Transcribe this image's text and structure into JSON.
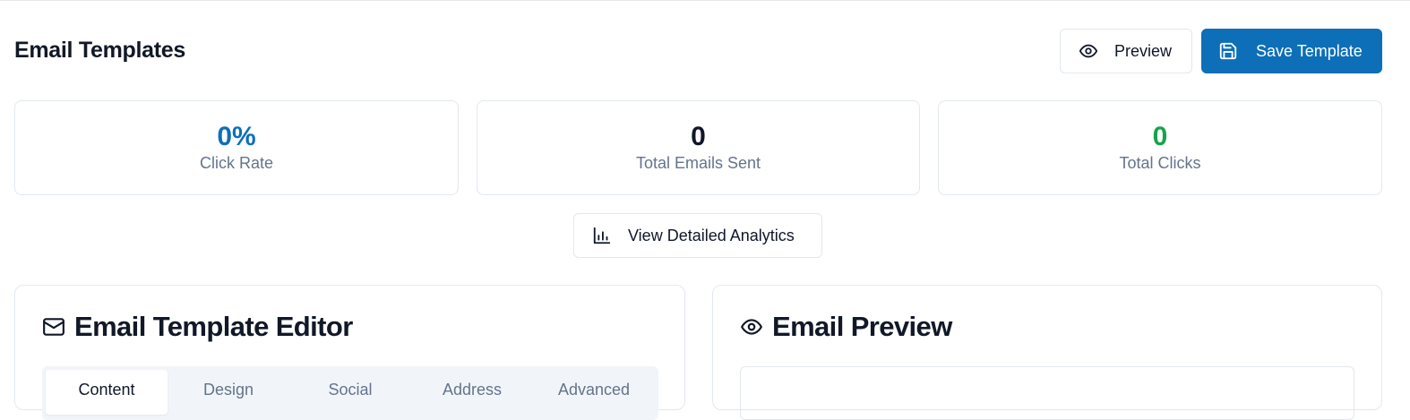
{
  "header": {
    "title": "Email Templates",
    "preview_label": "Preview",
    "save_label": "Save Template"
  },
  "stats": [
    {
      "value": "0%",
      "label": "Click Rate",
      "color": "#0d6fb8"
    },
    {
      "value": "0",
      "label": "Total Emails Sent",
      "color": "#0f172a"
    },
    {
      "value": "0",
      "label": "Total Clicks",
      "color": "#16a34a"
    }
  ],
  "analytics_button": {
    "label": "View Detailed Analytics",
    "icon": "bar-chart-icon"
  },
  "editor": {
    "title": "Email Template Editor",
    "icon": "mail-icon",
    "tabs": [
      {
        "label": "Content",
        "active": true
      },
      {
        "label": "Design",
        "active": false
      },
      {
        "label": "Social",
        "active": false
      },
      {
        "label": "Address",
        "active": false
      },
      {
        "label": "Advanced",
        "active": false
      }
    ]
  },
  "preview": {
    "title": "Email Preview",
    "icon": "eye-icon"
  },
  "colors": {
    "primary": "#0d6fb8",
    "success": "#16a34a",
    "border": "#e2e8f0",
    "muted": "#64748b"
  }
}
